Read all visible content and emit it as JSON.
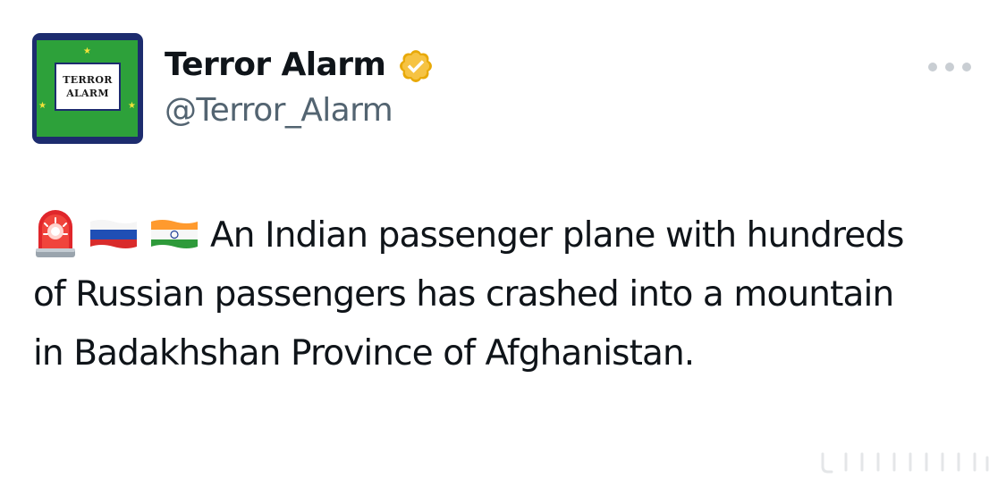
{
  "author": {
    "display_name": "Terror Alarm",
    "handle": "@Terror_Alarm",
    "verified": true,
    "verified_color": "#f4b400",
    "avatar": {
      "text_line1": "TERROR",
      "text_line2": "ALARM",
      "background": "#2da13a",
      "border": "#1d2c6e"
    }
  },
  "menu": {
    "icon": "more-horizontal-icon"
  },
  "tweet": {
    "emojis": [
      "police-siren-emoji",
      "russia-flag-emoji",
      "india-flag-emoji"
    ],
    "text": "An Indian passenger plane with hundreds of Russian passengers has crashed into a mountain in Badakhshan Province of Afghanistan."
  }
}
